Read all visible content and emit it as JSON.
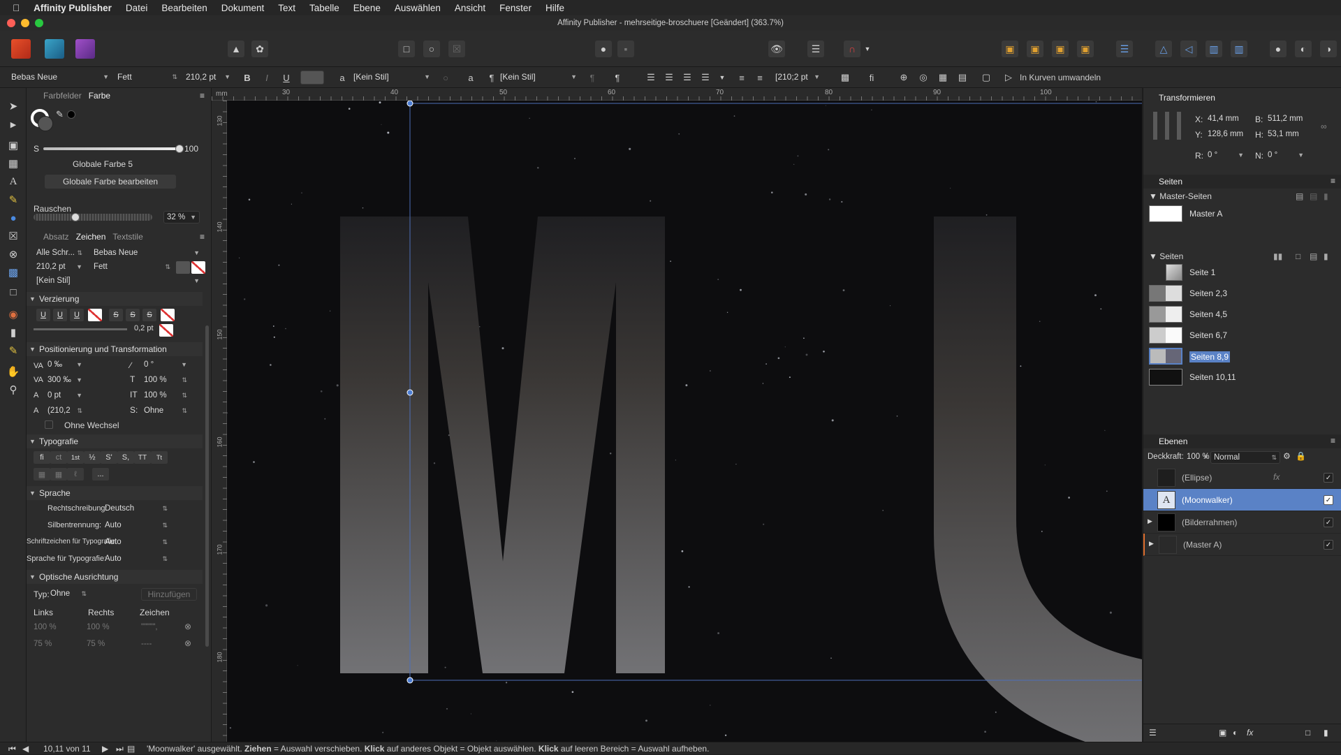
{
  "menubar": {
    "app": "Affinity Publisher",
    "items": [
      "Datei",
      "Bearbeiten",
      "Dokument",
      "Text",
      "Tabelle",
      "Ebene",
      "Auswählen",
      "Ansicht",
      "Fenster",
      "Hilfe"
    ]
  },
  "window": {
    "title": "Affinity Publisher - mehrseitige-broschuere [Geändert] (363.7%)"
  },
  "context": {
    "font": "Bebas Neue",
    "weight": "Fett",
    "size": "210,2 pt",
    "char_style": "[Kein Stil]",
    "para_style": "[Kein Stil]",
    "leading": "[210;2 pt",
    "convert": "In Kurven umwandeln"
  },
  "left_panel": {
    "tabs": [
      "Farbfelder",
      "Farbe"
    ],
    "s_label": "S",
    "s_value": "100",
    "color_name": "Globale Farbe 5",
    "edit_button": "Globale Farbe bearbeiten",
    "noise_label": "Rauschen",
    "noise_value": "32 %",
    "tabs2": [
      "Absatz",
      "Zeichen",
      "Textstile"
    ],
    "font_collection": "Alle Schr...",
    "font": "Bebas Neue",
    "size": "210,2 pt",
    "weight": "Fett",
    "style": "[Kein Stil]",
    "sections": {
      "decoration": "Verzierung",
      "positioning": "Positionierung und Transformation",
      "typography": "Typografie",
      "language": "Sprache",
      "optical": "Optische Ausrichtung"
    },
    "stroke_value": "0,2 pt",
    "pos": {
      "tracking": "0 ‰",
      "rotation": "0 °",
      "kerning": "300 ‰",
      "vscale": "100 %",
      "baseline": "0 pt",
      "hscale": "100 %",
      "leading": "(210,2",
      "shear": "Ohne"
    },
    "no_wrap": "Ohne Wechsel",
    "typo_buttons": [
      "fi",
      "ct",
      "1st",
      "½",
      "S'",
      "S,",
      "TT",
      "Tt"
    ],
    "more": "...",
    "lang": {
      "spell_label": "Rechtschreibung:",
      "spell": "Deutsch",
      "hyph_label": "Silbentrennung:",
      "hyph": "Auto",
      "script_label": "Schriftzeichen für Typografie:",
      "script": "Auto",
      "lang_label": "Sprache für Typografie:",
      "lang": "Auto"
    },
    "optical": {
      "type_label": "Typ:",
      "type": "Ohne",
      "add": "Hinzufügen",
      "cols": [
        "Links",
        "Rechts",
        "Zeichen"
      ],
      "rows": [
        [
          "100 %",
          "100 %",
          "\"\"\"\"\","
        ],
        [
          "75 %",
          "75 %",
          "----"
        ]
      ]
    }
  },
  "ruler": {
    "h_ticks": [
      "30",
      "40",
      "50",
      "60",
      "70",
      "80",
      "90",
      "100"
    ],
    "v_ticks": [
      "130",
      "140",
      "150",
      "160",
      "170",
      "180"
    ],
    "unit": "mm"
  },
  "canvas": {
    "letters": "MU"
  },
  "right_panel": {
    "transform": {
      "title": "Transformieren",
      "x_label": "X:",
      "x": "41,4 mm",
      "y_label": "Y:",
      "y": "128,6 mm",
      "b_label": "B:",
      "b": "511,2 mm",
      "h_label": "H:",
      "h": "53,1 mm",
      "r_label": "R:",
      "r": "0 °",
      "n_label": "N:",
      "n": "0 °"
    },
    "pages": {
      "title": "Seiten",
      "master_header": "Master-Seiten",
      "master": "Master A",
      "pages_header": "Seiten",
      "items": [
        "Seite 1",
        "Seiten 2,3",
        "Seiten 4,5",
        "Seiten 6,7",
        "Seiten 8,9",
        "Seiten 10,11"
      ]
    },
    "layers": {
      "title": "Ebenen",
      "opacity_label": "Deckkraft:",
      "opacity": "100 %",
      "blend": "Normal",
      "items": [
        "(Ellipse)",
        "(Moonwalker)",
        "(Bilderrahmen)",
        "(Master A)"
      ]
    }
  },
  "status": {
    "page": "10,11 von 11",
    "message_pre": "'Moonwalker' ausgewählt. ",
    "b1": "Ziehen",
    "t1": " = Auswahl verschieben. ",
    "b2": "Klick",
    "t2": " auf anderes Objekt = Objekt auswählen. ",
    "b3": "Klick",
    "t3": " auf leeren Bereich = Auswahl aufheben."
  },
  "colors": {
    "accent": "#4d7ed4",
    "selection": "#5a82c6",
    "canvas": "#0d0d0f"
  }
}
